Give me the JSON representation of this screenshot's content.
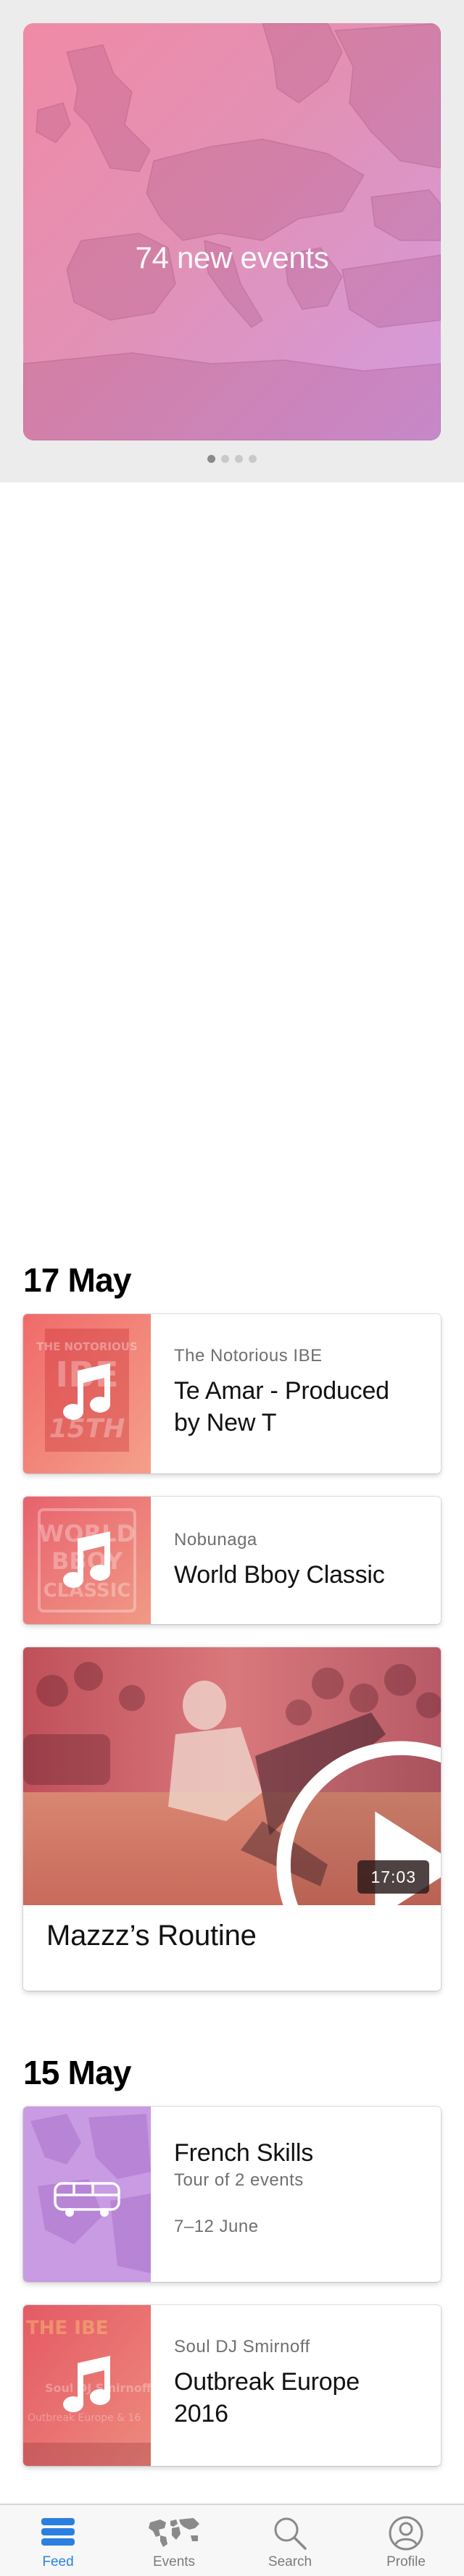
{
  "hero": {
    "title": "74 new events",
    "page_count": 4,
    "active_page": 1
  },
  "sections": [
    {
      "date": "17 May",
      "items": [
        {
          "type": "track",
          "subtitle": "The Notorious IBE",
          "title_line1": "Te Amar - Produced",
          "title_line2": "by New T",
          "thumb_icon": "music-note-icon",
          "thumb_text": "THE NOTORIOUS IBE 15TH"
        },
        {
          "type": "track",
          "subtitle": "Nobunaga",
          "title": "World Bboy Classic",
          "thumb_icon": "music-note-icon",
          "thumb_text": "WORLD BBOY CLASSIC"
        },
        {
          "type": "video",
          "title": "Mazzz’s Routine",
          "duration": "17:03",
          "thumb_icon": "play-icon"
        }
      ]
    },
    {
      "date": "15 May",
      "items": [
        {
          "type": "tour",
          "title": "French Skills",
          "subtitle": "Tour of 2 events",
          "dates": "7–12 June",
          "thumb_icon": "bus-icon"
        },
        {
          "type": "track",
          "subtitle": "Soul DJ Smirnoff",
          "title_line1": "Outbreak Europe",
          "title_line2": "2016",
          "thumb_icon": "music-note-icon",
          "thumb_text": "THE IBE Soul DJ Smirnoff Outbreak Europe"
        }
      ]
    }
  ],
  "tabbar": {
    "tabs": [
      {
        "label": "Feed",
        "icon": "feed-icon",
        "active": true
      },
      {
        "label": "Events",
        "icon": "world-map-icon",
        "active": false
      },
      {
        "label": "Search",
        "icon": "search-icon",
        "active": false
      },
      {
        "label": "Profile",
        "icon": "profile-icon",
        "active": false
      }
    ]
  },
  "colors": {
    "accent": "#2b7fe0",
    "hero_gradient_start": "#f08aa6",
    "hero_gradient_end": "#d39be0",
    "tour_thumb": "#c99be3"
  }
}
